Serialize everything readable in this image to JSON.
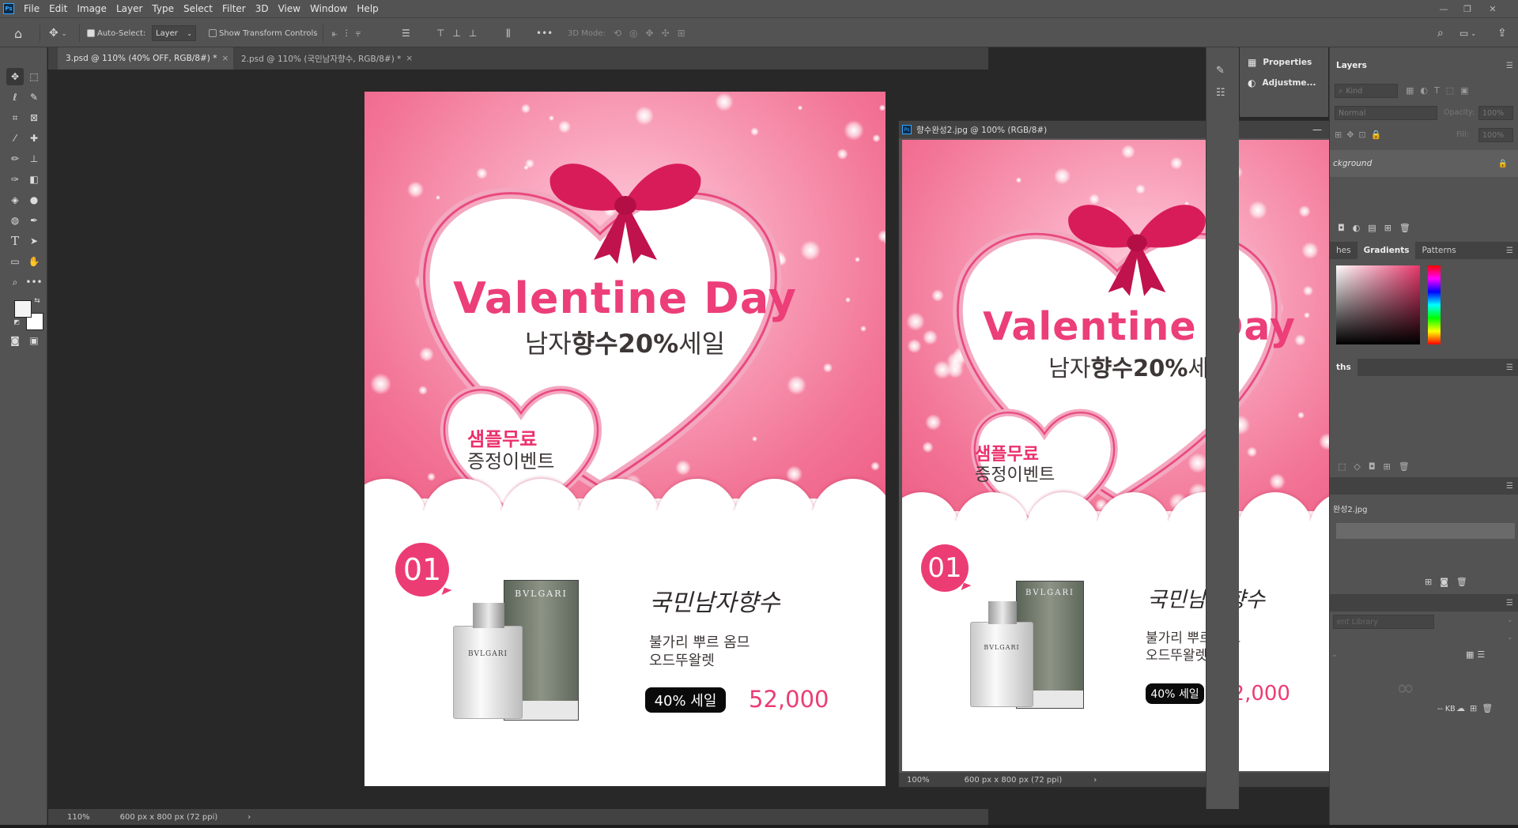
{
  "app": {
    "logo": "Ps"
  },
  "menubar": {
    "items": [
      "File",
      "Edit",
      "Image",
      "Layer",
      "Type",
      "Select",
      "Filter",
      "3D",
      "View",
      "Window",
      "Help"
    ]
  },
  "options": {
    "auto_select": "Auto-Select:",
    "auto_select_target": "Layer",
    "show_transform": "Show Transform Controls",
    "mode_3d": "3D Mode:",
    "more": "•••"
  },
  "tabs": [
    {
      "label": "3.psd @ 110% (40% OFF, RGB/8#) *",
      "close": "×"
    },
    {
      "label": "2.psd @ 110% (국민남자향수, RGB/8#) *",
      "close": "×"
    }
  ],
  "artwork": {
    "title_en": "Valentine Day",
    "title_ko_prefix": "남자",
    "title_ko_bold": "향수20%",
    "title_ko_suffix": "세일",
    "sample_pink": "샘플무료",
    "sample_event": "증정이벤트",
    "badge_number": "01",
    "product_script": "국민남자향수",
    "desc_line1": "불가리 뿌르 옴므",
    "desc_line2": "오드뚜왈렛",
    "sale_pill": "40% 세일",
    "price": "52,000",
    "brand_box": "BVLGARI",
    "brand_bottle": "BVLGARI"
  },
  "status": {
    "zoom": "110%",
    "doc_info": "600 px x 800 px (72 ppi)"
  },
  "float_window": {
    "title": "향수완성2.jpg @ 100% (RGB/8#)",
    "zoom": "100%",
    "doc_info": "600 px x 800 px (72 ppi)"
  },
  "panels": {
    "properties": "Properties",
    "adjustments": "Adjustme...",
    "layers_tab": "Layers",
    "kind_placeholder": "Kind",
    "blend_mode": "Normal",
    "opacity_label": "Opacity:",
    "opacity_value": "100%",
    "fill_label": "Fill:",
    "fill_value": "100%",
    "layer_name": "ckground",
    "swatches_partial": "hes",
    "gradients": "Gradients",
    "patterns": "Patterns",
    "paths_partial": "ths",
    "history_file": "완성2.jpg",
    "library_partial": "ent Library",
    "kb_label": "-- KB"
  },
  "colors": {
    "accent_pink": "#ec3c74",
    "ui_bg": "#535353",
    "canvas_bg": "#282828"
  }
}
